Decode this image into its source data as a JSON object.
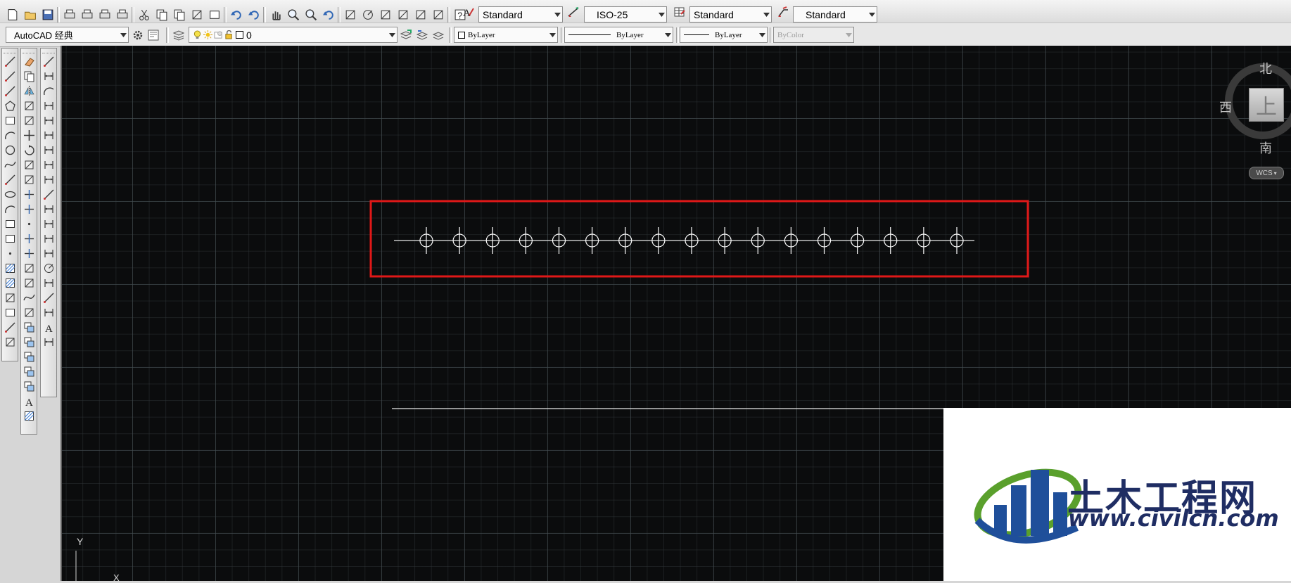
{
  "toolbar_top": {
    "text_style": "Standard",
    "dim_style": "ISO-25",
    "table_style": "Standard",
    "mleader_style": "Standard"
  },
  "toolbar_second": {
    "workspace": "AutoCAD 经典",
    "layer": "0",
    "color": "ByLayer",
    "linetype": "ByLayer",
    "lineweight": "ByLayer",
    "plot_style": "ByColor"
  },
  "viewcube": {
    "north": "北",
    "south": "南",
    "west": "西",
    "top_face": "上",
    "ucs_label": "WCS"
  },
  "ucs_icon": {
    "y_label": "Y",
    "x_label": "X"
  },
  "drawing": {
    "circle_count": 17,
    "highlight_color": "#e01818",
    "line_color": "#ffffff"
  },
  "watermark": {
    "name": "土木工程网",
    "url": "www.civilcn.com",
    "brand_blue": "#1f4f9a",
    "brand_green": "#5aa02c"
  },
  "icons_top": [
    "new-icon",
    "open-icon",
    "save-icon",
    "plot-icon",
    "plot-preview-icon",
    "publish-icon",
    "3d-print-icon",
    "cut-icon",
    "copy-icon",
    "paste-icon",
    "match-properties-icon",
    "block-editor-icon",
    "undo-icon",
    "redo-icon",
    "pan-icon",
    "zoom-realtime-icon",
    "zoom-window-icon",
    "zoom-previous-icon",
    "properties-icon",
    "design-center-icon",
    "tool-palettes-icon",
    "sheet-set-icon",
    "markup-icon",
    "quickcalc-icon",
    "help-icon"
  ],
  "icons_draw": [
    "line-icon",
    "construction-line-icon",
    "polyline-icon",
    "polygon-icon",
    "rectangle-icon",
    "arc-icon",
    "circle-icon",
    "revision-cloud-icon",
    "spline-icon",
    "ellipse-icon",
    "ellipse-arc-icon",
    "insert-block-icon",
    "make-block-icon",
    "point-icon",
    "hatch-icon",
    "gradient-icon",
    "region-icon",
    "table-icon",
    "multiline-text-icon",
    "add-selected-icon"
  ],
  "icons_modify": [
    "erase-icon",
    "copy-object-icon",
    "mirror-icon",
    "offset-icon",
    "array-icon",
    "move-icon",
    "rotate-icon",
    "scale-icon",
    "stretch-icon",
    "trim-icon",
    "extend-icon",
    "break-at-point-icon",
    "break-icon",
    "join-icon",
    "chamfer-icon",
    "fillet-icon",
    "blend-curves-icon",
    "explode-icon",
    "draw-order-icon",
    "bring-front-icon",
    "send-back-icon",
    "bring-above-icon",
    "send-under-icon",
    "text-front-icon",
    "hatch-back-icon"
  ],
  "icons_dim": [
    "linear-dim-icon",
    "aligned-dim-icon",
    "arc-length-icon",
    "ordinate-dim-icon",
    "radius-dim-icon",
    "jogged-dim-icon",
    "diameter-dim-icon",
    "angular-dim-icon",
    "quick-dim-icon",
    "baseline-dim-icon",
    "continue-dim-icon",
    "dim-space-icon",
    "dim-break-icon",
    "tolerance-icon",
    "center-mark-icon",
    "inspection-icon",
    "jogged-linear-icon",
    "dim-edit-icon",
    "dim-text-edit-icon",
    "dim-update-icon"
  ]
}
